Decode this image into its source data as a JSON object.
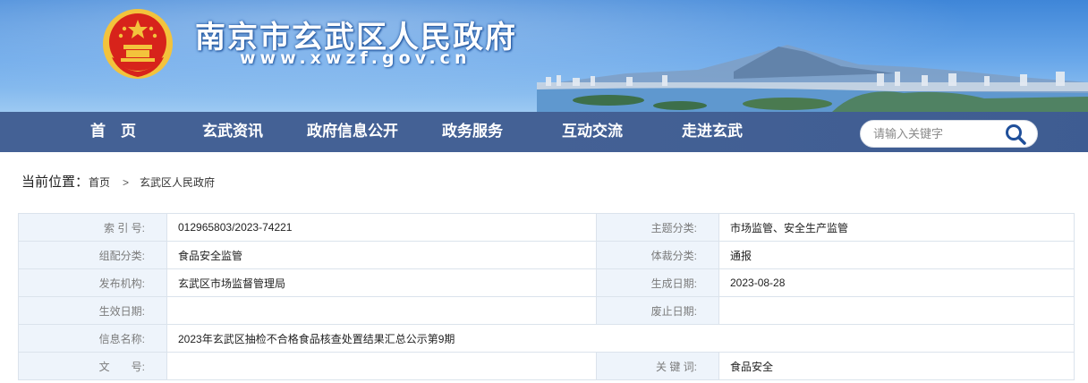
{
  "header": {
    "site_title": "南京市玄武区人民政府",
    "site_url": "www.xwzf.gov.cn",
    "emblem_icon": "national-emblem-icon"
  },
  "nav": {
    "items": [
      {
        "label": "首　页"
      },
      {
        "label": "玄武资讯"
      },
      {
        "label": "政府信息公开"
      },
      {
        "label": "政务服务"
      },
      {
        "label": "互动交流"
      },
      {
        "label": "走进玄武"
      }
    ],
    "search_placeholder": "请输入关键字",
    "search_icon": "search-icon"
  },
  "breadcrumb": {
    "label": "当前位置：",
    "items": [
      "首页",
      "玄武区人民政府"
    ],
    "separator": ">"
  },
  "meta": {
    "rows": [
      {
        "l1": "索 引 号:",
        "v1": "012965803/2023-74221",
        "l2": "主题分类:",
        "v2": "市场监管、安全生产监管"
      },
      {
        "l1": "组配分类:",
        "v1": "食品安全监管",
        "l2": "体裁分类:",
        "v2": "通报"
      },
      {
        "l1": "发布机构:",
        "v1": "玄武区市场监督管理局",
        "l2": "生成日期:",
        "v2": "2023-08-28"
      },
      {
        "l1": "生效日期:",
        "v1": "",
        "l2": "废止日期:",
        "v2": ""
      },
      {
        "l1": "信息名称:",
        "v_full": "2023年玄武区抽检不合格食品核查处置结果汇总公示第9期"
      },
      {
        "l1": "文　　号:",
        "v1": "",
        "l2": "关 键 词:",
        "v2": "食品安全"
      }
    ]
  },
  "colors": {
    "nav_bg": "#34548c",
    "label_bg": "#eef4fb",
    "border": "#dbe3ec",
    "emblem_red": "#d7231b",
    "emblem_gold": "#f3c33c"
  }
}
